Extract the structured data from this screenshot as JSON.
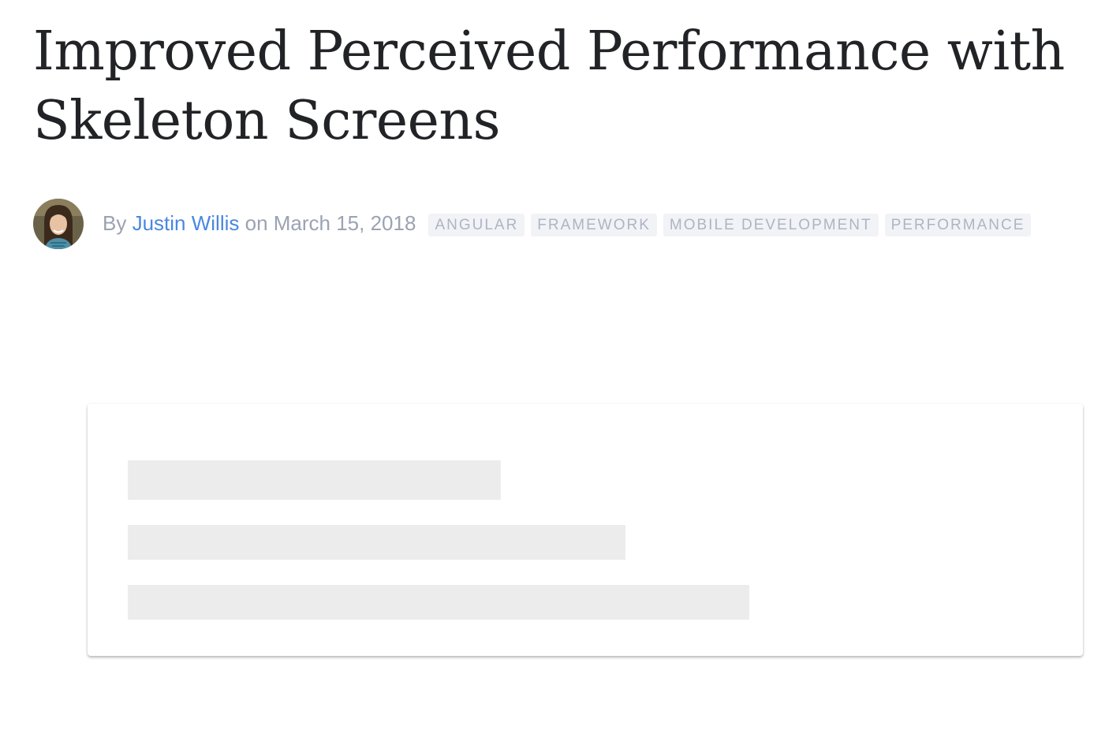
{
  "article": {
    "title": "Improved Perceived Performance with Skeleton Screens"
  },
  "meta": {
    "by_label": "By",
    "author": "Justin Willis",
    "on_label": "on",
    "date": "March 15, 2018",
    "avatar_icon": "author-avatar",
    "tags": [
      "ANGULAR",
      "FRAMEWORK",
      "MOBILE DEVELOPMENT",
      "PERFORMANCE"
    ]
  },
  "colors": {
    "title": "#222326",
    "meta_text": "#9aa3b2",
    "author_link": "#4a87e0",
    "tag_background": "#f1f3f7",
    "tag_text": "#aeb5c2",
    "skeleton_bar": "#ececec"
  }
}
